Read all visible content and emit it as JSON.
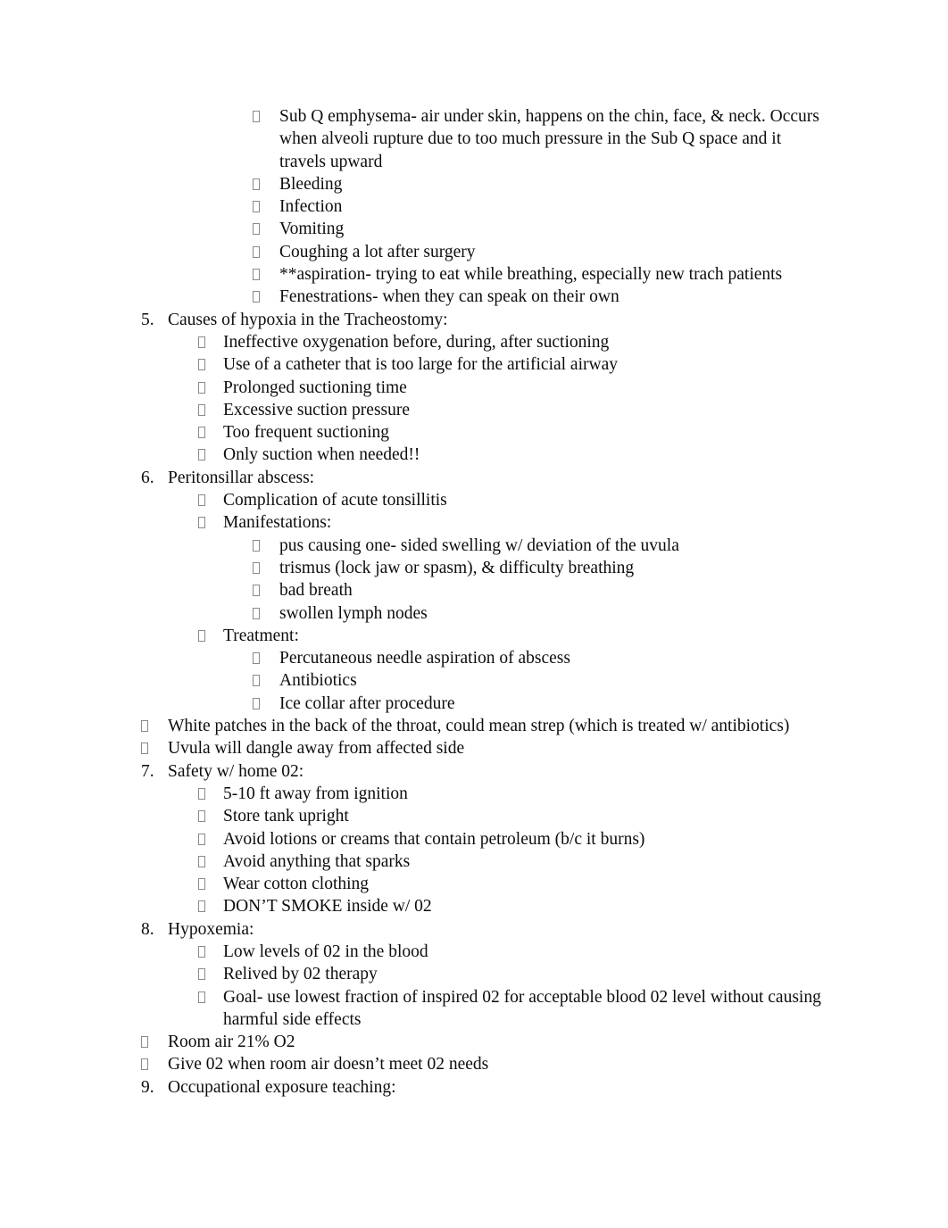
{
  "document": {
    "page_background": "#ffffff",
    "text_color": "#0d0d0d",
    "bullet_glyph_name": "wingdings-bullet-tofu-box",
    "blocks": [
      {
        "id": "tracheostomy-complications",
        "level": 3,
        "marker_type": "bullet",
        "items": [
          "Sub Q emphysema- air under skin, happens on the chin, face, & neck. Occurs when alveoli rupture due to too much pressure in the Sub Q space and it travels upward",
          "Bleeding",
          "Infection",
          "Vomiting",
          "Coughing a lot after surgery",
          "**aspiration- trying to eat while breathing, especially new trach patients",
          "Fenestrations- when they can speak on their own"
        ]
      },
      {
        "id": "item-5",
        "level": 1,
        "marker_type": "number",
        "marker": "5.",
        "text": "Causes of hypoxia in the Tracheostomy:"
      },
      {
        "id": "hypoxia-causes",
        "level": 2,
        "marker_type": "bullet",
        "items": [
          "Ineffective oxygenation before, during, after suctioning",
          "Use of a catheter that is too large for the artificial airway",
          "Prolonged suctioning time",
          "Excessive suction pressure",
          "Too frequent suctioning",
          "Only suction when needed!!"
        ]
      },
      {
        "id": "item-6",
        "level": 1,
        "marker_type": "number",
        "marker": "6.",
        "text": "Peritonsillar abscess:"
      },
      {
        "id": "abscess-complication",
        "level": 2,
        "marker_type": "bullet",
        "items": [
          "Complication of acute tonsillitis",
          "Manifestations:"
        ]
      },
      {
        "id": "abscess-manifestations",
        "level": 3,
        "marker_type": "bullet",
        "items": [
          "pus causing one- sided swelling w/ deviation of the uvula",
          "trismus (lock jaw or spasm), & difficulty breathing",
          "bad breath",
          "swollen lymph nodes"
        ]
      },
      {
        "id": "abscess-treatment-heading",
        "level": 2,
        "marker_type": "bullet",
        "items": [
          "Treatment:"
        ]
      },
      {
        "id": "abscess-treatment",
        "level": 3,
        "marker_type": "bullet",
        "items": [
          "Percutaneous needle aspiration of abscess",
          "Antibiotics",
          "Ice collar after procedure"
        ]
      },
      {
        "id": "throat-notes",
        "level": 1,
        "marker_type": "bullet",
        "items": [
          "White patches in the back of the throat, could mean strep (which is treated w/ antibiotics)",
          "Uvula will dangle away from affected side"
        ]
      },
      {
        "id": "item-7",
        "level": 1,
        "marker_type": "number",
        "marker": "7.",
        "text": "Safety w/ home 02:"
      },
      {
        "id": "home-o2-safety",
        "level": 2,
        "marker_type": "bullet",
        "items": [
          "5-10 ft away from ignition",
          "Store tank upright",
          "Avoid lotions or creams that contain petroleum (b/c it burns)",
          "Avoid anything that sparks",
          "Wear cotton clothing",
          "DON’T SMOKE inside w/ 02"
        ]
      },
      {
        "id": "item-8",
        "level": 1,
        "marker_type": "number",
        "marker": "8.",
        "text": "Hypoxemia:"
      },
      {
        "id": "hypoxemia-details",
        "level": 2,
        "marker_type": "bullet",
        "items": [
          "Low levels of 02 in the blood",
          "Relived by 02 therapy",
          "Goal- use lowest fraction of inspired 02 for acceptable blood 02 level without causing harmful side effects"
        ]
      },
      {
        "id": "room-air-notes",
        "level": 1,
        "marker_type": "bullet",
        "items": [
          "Room air 21% O2",
          "Give 02 when room air doesn’t meet 02 needs"
        ]
      },
      {
        "id": "item-9",
        "level": 1,
        "marker_type": "number",
        "marker": "9.",
        "text": "Occupational exposure teaching:"
      }
    ]
  }
}
